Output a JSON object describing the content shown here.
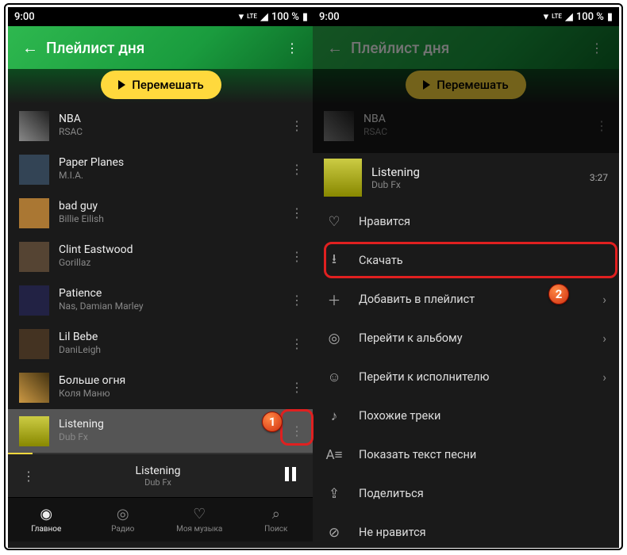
{
  "statusbar": {
    "time": "9:00",
    "lte": "LTE",
    "battery": "100 %"
  },
  "header": {
    "title": "Плейлист дня"
  },
  "shuffle": {
    "label": "Перемешать"
  },
  "tracks": [
    {
      "title": "NBA",
      "artist": "RSAC"
    },
    {
      "title": "Paper Planes",
      "artist": "M.I.A."
    },
    {
      "title": "bad guy",
      "artist": "Billie Eilish"
    },
    {
      "title": "Clint Eastwood",
      "artist": "Gorillaz"
    },
    {
      "title": "Patience",
      "artist": "Nas, Damian Marley"
    },
    {
      "title": "Lil Bebe",
      "artist": "DaniLeigh"
    },
    {
      "title": "Больше огня",
      "artist": "Коля Маню"
    },
    {
      "title": "Listening",
      "artist": "Dub Fx"
    }
  ],
  "miniplayer": {
    "title": "Listening",
    "artist": "Dub Fx"
  },
  "nav": {
    "home": "Главное",
    "radio": "Радио",
    "mymusic": "Моя музыка",
    "search": "Поиск"
  },
  "context": {
    "track_title": "Listening",
    "track_artist": "Dub Fx",
    "duration": "3:27"
  },
  "menu": {
    "like": "Нравится",
    "download": "Скачать",
    "add_playlist": "Добавить в плейлист",
    "goto_album": "Перейти к альбому",
    "goto_artist": "Перейти к исполнителю",
    "similar": "Похожие треки",
    "lyrics": "Показать текст песни",
    "share": "Поделиться",
    "dislike": "Не нравится"
  },
  "callouts": {
    "one": "1",
    "two": "2"
  }
}
